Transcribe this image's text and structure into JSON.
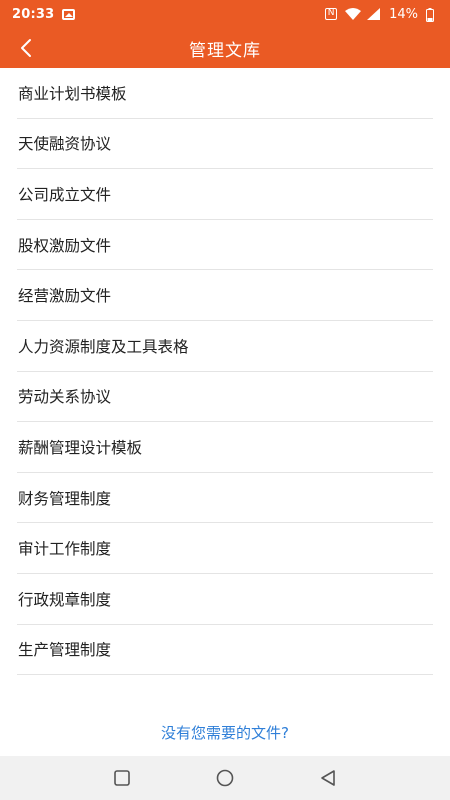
{
  "status_bar": {
    "time": "20:33",
    "battery_text": "14%",
    "icons": [
      "image-icon",
      "nfc-icon",
      "wifi-icon",
      "signal-icon",
      "battery-icon"
    ]
  },
  "app_bar": {
    "title": "管理文库",
    "back_icon": "chevron-left-icon",
    "color": "#ea5a24"
  },
  "list": {
    "items": [
      "商业计划书模板",
      "天使融资协议",
      "公司成立文件",
      "股权激励文件",
      "经营激励文件",
      "人力资源制度及工具表格",
      "劳动关系协议",
      "薪酬管理设计模板",
      "财务管理制度",
      "审计工作制度",
      "行政规章制度",
      "生产管理制度"
    ]
  },
  "footer": {
    "link_text": "没有您需要的文件?",
    "link_color": "#2f7fd8"
  },
  "nav_bar": {
    "icons": [
      "square-recents-icon",
      "circle-home-icon",
      "triangle-back-icon"
    ]
  }
}
